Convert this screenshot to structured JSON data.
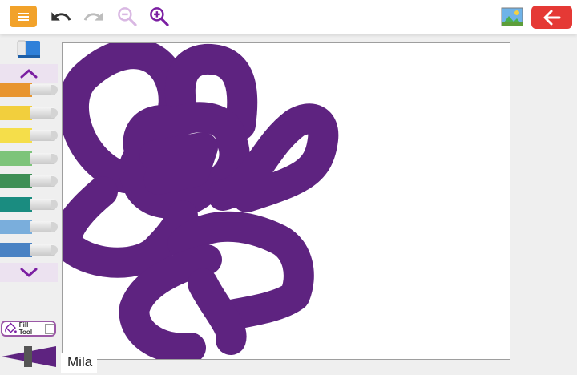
{
  "app": {
    "user_name": "Mila"
  },
  "toolbar": {
    "menu_icon": "menu-icon",
    "undo_icon": "undo-icon",
    "redo_icon": "redo-icon",
    "zoom_out_icon": "zoom-out-icon",
    "zoom_in_icon": "zoom-in-icon",
    "image_icon": "image-icon",
    "back_icon": "back-arrow-icon",
    "colors": {
      "menu": "#f2a22a",
      "back": "#e53935",
      "zoom_active": "#7b1fa2",
      "zoom_disabled": "#d9b8e3"
    }
  },
  "sidebar": {
    "eraser_icon": "eraser-icon",
    "scroll_up_icon": "chevron-up-icon",
    "scroll_down_icon": "chevron-down-icon",
    "markers": [
      {
        "color": "#e8952f",
        "selected": false
      },
      {
        "color": "#f2cf3d",
        "selected": false
      },
      {
        "color": "#f5de4a",
        "selected": false
      },
      {
        "color": "#7dc47a",
        "selected": false
      },
      {
        "color": "#3e8f55",
        "selected": false
      },
      {
        "color": "#1a8c80",
        "selected": false
      },
      {
        "color": "#7aaedc",
        "selected": false
      },
      {
        "color": "#4a82c4",
        "selected": false
      },
      {
        "color": "#632a8c",
        "selected": true
      },
      {
        "color": "#9b6cc4",
        "selected": false
      }
    ],
    "fill_tool": {
      "label": "Fill Tool",
      "checked": false
    },
    "brush_color": "#5e2380"
  },
  "canvas": {
    "stroke_color": "#5e2380",
    "background": "#ffffff"
  }
}
